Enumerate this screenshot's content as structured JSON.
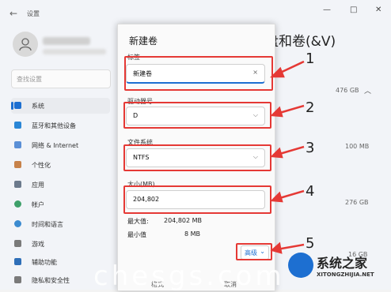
{
  "window": {
    "app_title": "设置",
    "controls": [
      "—",
      "□",
      "✕"
    ]
  },
  "sidebar": {
    "search_placeholder": "查找设置",
    "items": [
      {
        "label": "系统",
        "color": "#1d6fd1"
      },
      {
        "label": "蓝牙和其他设备",
        "color": "#2a86d6"
      },
      {
        "label": "网络 & Internet",
        "color": "#5a8fd6"
      },
      {
        "label": "个性化",
        "color": "#c7824a"
      },
      {
        "label": "应用",
        "color": "#6c7a8c"
      },
      {
        "label": "帐户",
        "color": "#3ea06a"
      },
      {
        "label": "时间和语言",
        "color": "#3c8bd0"
      },
      {
        "label": "游戏",
        "color": "#7a7a7a"
      },
      {
        "label": "辅助功能",
        "color": "#2f6fb8"
      },
      {
        "label": "隐私和安全性",
        "color": "#7a7a7a"
      }
    ]
  },
  "right_panel": {
    "heading": "盘和卷(&V)",
    "sizes": [
      "476 GB",
      "100 MB",
      "276 GB",
      "16 GB"
    ]
  },
  "dialog": {
    "title": "新建卷",
    "label_field": {
      "label": "标签",
      "value": "新建卷",
      "clear": "×"
    },
    "drive_letter": {
      "label": "驱动器号",
      "value": "D"
    },
    "file_system": {
      "label": "文件系统",
      "value": "NTFS"
    },
    "size": {
      "label": "大小(MB)",
      "value": "204,802"
    },
    "max_label": "最大值:",
    "max_value": "204,802 MB",
    "min_label": "最小值",
    "min_value": "8 MB",
    "advanced": "高级",
    "footer": [
      "格式",
      "取消"
    ]
  },
  "annotations": {
    "numbers": [
      "1",
      "2",
      "3",
      "4",
      "5"
    ],
    "color": "#e53935"
  },
  "watermark": {
    "text": "chesgs.com",
    "logo_title": "系统之家",
    "logo_sub": "XITONGZHIJIA.NET"
  }
}
